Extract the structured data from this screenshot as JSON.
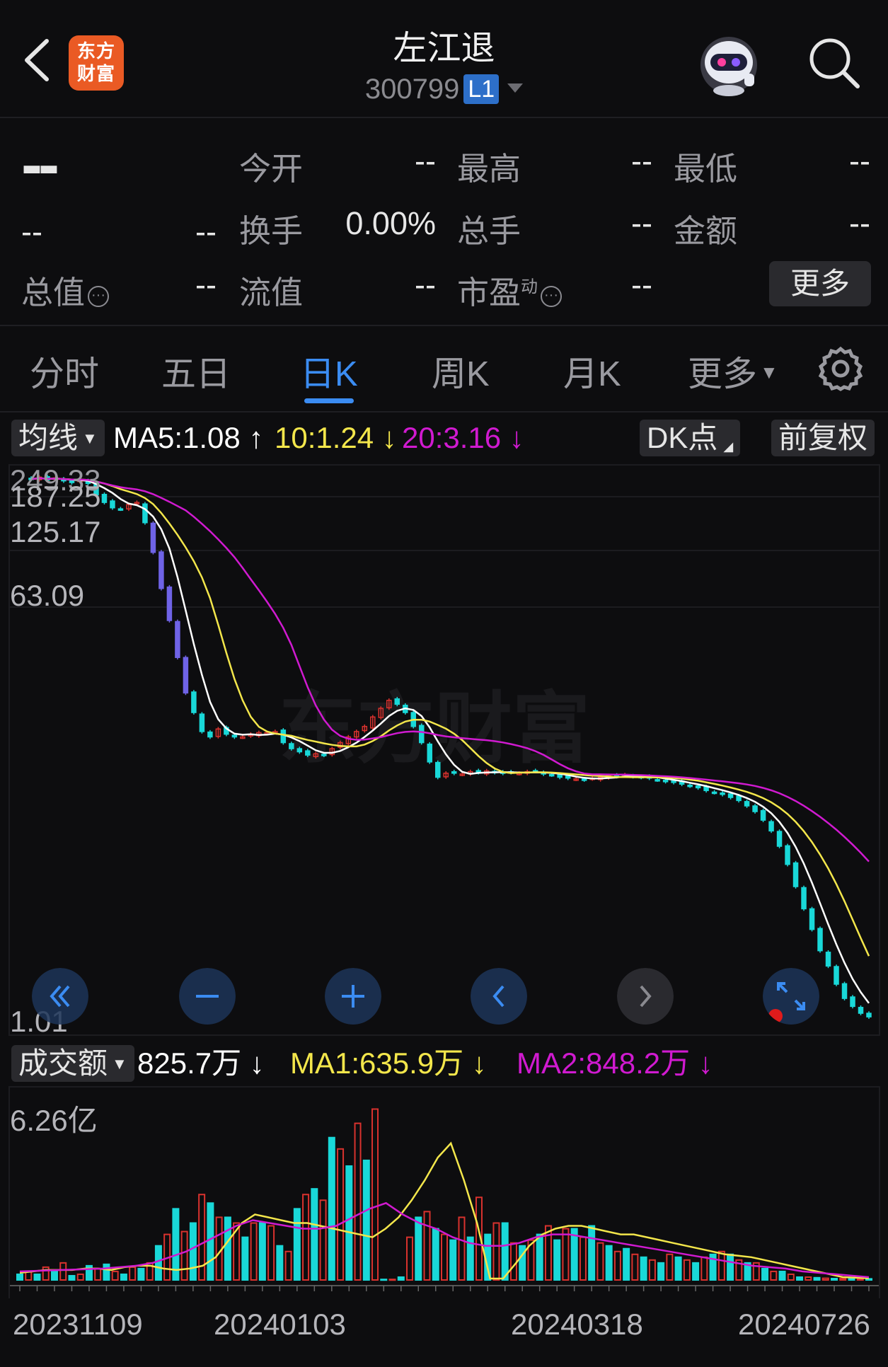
{
  "header": {
    "title": "左江退",
    "code": "300799",
    "level": "L1",
    "logo_text_line1": "东方",
    "logo_text_line2": "财富"
  },
  "quote": {
    "price": "--",
    "change": "--",
    "change_pct": "--",
    "fields": [
      {
        "label": "今开",
        "value": "--"
      },
      {
        "label": "最高",
        "value": "--"
      },
      {
        "label": "最低",
        "value": "--"
      },
      {
        "label": "换手",
        "value": "0.00%"
      },
      {
        "label": "总手",
        "value": "--"
      },
      {
        "label": "金额",
        "value": "--"
      },
      {
        "label": "总值",
        "value": "--"
      },
      {
        "label": "流值",
        "value": "--"
      },
      {
        "label": "市盈",
        "value": "--"
      }
    ],
    "pe_sup": "动",
    "info_glyph": "···",
    "more_label": "更多"
  },
  "tabs": {
    "items": [
      "分时",
      "五日",
      "日K",
      "周K",
      "月K",
      "更多"
    ],
    "active": "日K"
  },
  "ma_bar": {
    "mode": "均线",
    "ma5": "MA5:1.08 ↑",
    "ma10": "10:1.24 ↓",
    "ma20": "20:3.16 ↓",
    "dk": "DK点",
    "adjust": "前复权"
  },
  "vol_bar": {
    "mode": "成交额",
    "value": "825.7万 ↓",
    "ma1": "MA1:635.9万 ↓",
    "ma2": "MA2:848.2万 ↓"
  },
  "colors": {
    "up": "#d9322e",
    "down": "#19d8d8",
    "ma5": "#ffffff",
    "ma10": "#f3e64b",
    "ma20": "#d01ad0",
    "accent": "#3b8cf2",
    "limit_up": "#f2a51b",
    "limit_down": "#6f63e6"
  },
  "chart_data": [
    {
      "type": "candlestick",
      "scale": "log",
      "y_ticks": [
        "249.33",
        "187.25",
        "125.17",
        "63.09",
        "1.01"
      ],
      "watermark": "东方财富",
      "x_labels": [
        "20231109",
        "20240103",
        "20240318",
        "20240726"
      ],
      "closes": [
        240,
        245,
        238,
        243,
        236,
        232,
        240,
        230,
        205,
        190,
        180,
        178,
        186,
        190,
        155,
        115,
        80,
        58,
        40,
        28,
        23,
        19,
        18,
        19.5,
        18.5,
        18,
        18,
        18.5,
        18.8,
        18.8,
        19,
        17,
        16,
        15.5,
        15,
        15.2,
        15,
        16,
        17,
        18,
        19,
        20,
        22,
        24,
        26,
        25,
        23,
        20,
        17,
        14,
        12,
        12.5,
        12.5,
        12.4,
        12.7,
        12.6,
        12.8,
        12.6,
        12.5,
        12.6,
        12.5,
        12.7,
        12.8,
        12.4,
        12.3,
        12,
        11.9,
        11.8,
        11.7,
        11.9,
        12,
        12.2,
        12.1,
        12.3,
        12.1,
        12,
        11.9,
        11.7,
        11.5,
        11.4,
        11.2,
        11,
        10.8,
        10.5,
        10.3,
        10.1,
        9.8,
        9.5,
        9,
        8.5,
        7.8,
        7,
        6,
        5,
        4,
        3.2,
        2.6,
        2.1,
        1.8,
        1.5,
        1.3,
        1.2,
        1.12,
        1.08
      ]
    },
    {
      "type": "bar",
      "name_label": "成交额",
      "y_ticks": [
        "6.26亿"
      ],
      "values": [
        0.2,
        0.3,
        0.2,
        0.45,
        0.3,
        0.6,
        0.15,
        0.2,
        0.5,
        0.4,
        0.55,
        0.3,
        0.2,
        0.45,
        0.4,
        0.6,
        1.2,
        1.6,
        2.5,
        1.7,
        2.0,
        3.0,
        2.7,
        2.2,
        2.2,
        2.0,
        1.5,
        2.0,
        2.0,
        1.9,
        1.2,
        1.0,
        2.5,
        3.0,
        3.2,
        2.8,
        5.0,
        4.6,
        4.0,
        5.5,
        4.2,
        6.0,
        0.02,
        0.02,
        0.1,
        1.5,
        2.2,
        2.4,
        1.8,
        1.6,
        1.4,
        2.2,
        1.5,
        2.9,
        1.6,
        2.0,
        2.0,
        1.3,
        1.2,
        1.4,
        1.6,
        1.9,
        1.4,
        1.8,
        1.8,
        1.5,
        1.9,
        1.3,
        1.2,
        1.0,
        1.1,
        0.9,
        0.8,
        0.7,
        0.6,
        0.9,
        0.8,
        0.7,
        0.6,
        0.8,
        0.9,
        1.0,
        0.9,
        0.7,
        0.6,
        0.6,
        0.4,
        0.3,
        0.3,
        0.2,
        0.1,
        0.1,
        0.08,
        0.06,
        0.05,
        0.05,
        0.04,
        0.05,
        0.04
      ],
      "ma1": [
        0.25,
        0.3,
        0.35,
        0.35,
        0.35,
        0.4,
        0.4,
        0.35,
        0.45,
        0.5,
        0.5,
        0.4,
        0.35,
        0.4,
        0.5,
        0.8,
        1.4,
        2.0,
        2.3,
        2.2,
        2.1,
        2.0,
        2.0,
        1.9,
        1.8,
        1.7,
        1.6,
        1.5,
        1.8,
        2.2,
        2.8,
        3.5,
        4.3,
        4.8,
        3.5,
        2.0,
        0.05,
        0.05,
        0.6,
        1.2,
        1.6,
        1.8,
        1.9,
        1.9,
        1.8,
        1.7,
        1.6,
        1.6,
        1.5,
        1.4,
        1.3,
        1.2,
        1.1,
        1.0,
        0.9,
        0.85,
        0.8,
        0.7,
        0.6,
        0.5,
        0.4,
        0.3,
        0.2,
        0.1,
        0.08,
        0.06
      ],
      "ma2": [
        0.3,
        0.32,
        0.34,
        0.36,
        0.38,
        0.4,
        0.45,
        0.5,
        0.6,
        0.8,
        1.0,
        1.3,
        1.6,
        1.9,
        2.1,
        2.0,
        1.9,
        1.8,
        1.8,
        1.9,
        2.2,
        2.5,
        2.7,
        2.3,
        2.0,
        1.8,
        1.5,
        1.3,
        1.2,
        1.2,
        1.3,
        1.5,
        1.6,
        1.6,
        1.5,
        1.4,
        1.3,
        1.2,
        1.1,
        1.0,
        0.9,
        0.8,
        0.7,
        0.6,
        0.5,
        0.45,
        0.4,
        0.3,
        0.25,
        0.2,
        0.15,
        0.1
      ]
    }
  ]
}
